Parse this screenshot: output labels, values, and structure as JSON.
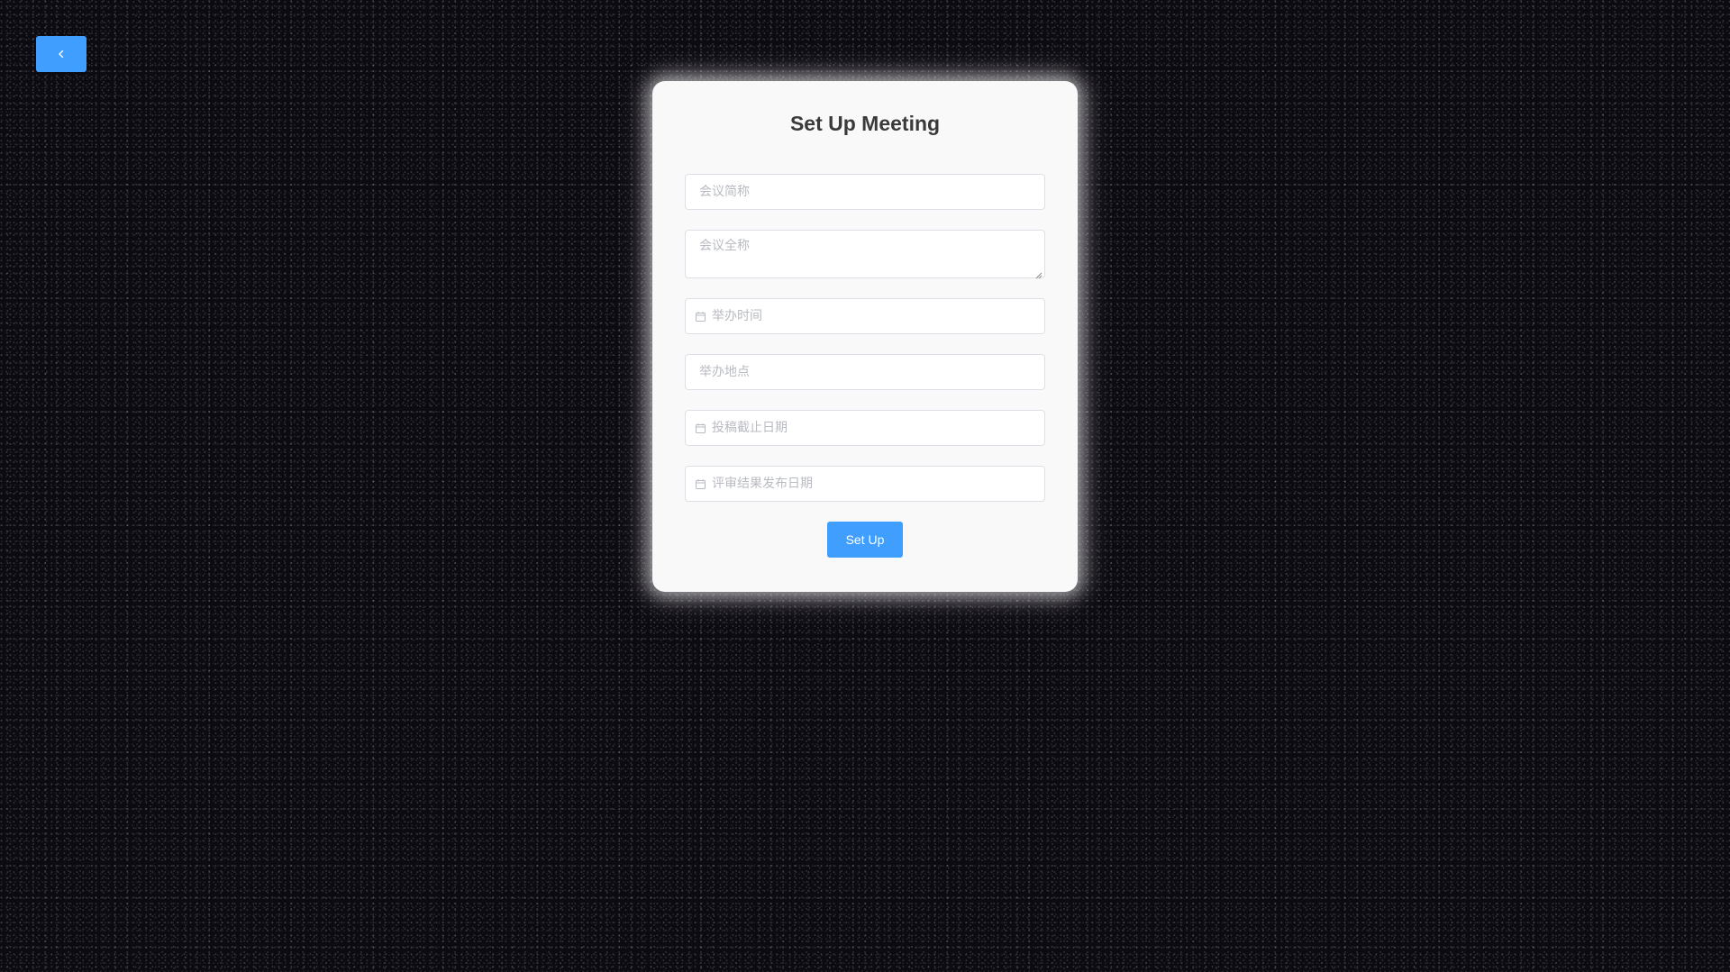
{
  "page": {
    "title": "Set Up Meeting"
  },
  "nav": {
    "back_icon": "chevron-left-icon",
    "accent_color": "#409eff"
  },
  "form": {
    "short_name": {
      "value": "",
      "placeholder": "会议简称"
    },
    "full_name": {
      "value": "",
      "placeholder": "会议全称"
    },
    "held_time": {
      "value": "",
      "placeholder": "举办时间",
      "icon": "calendar-icon"
    },
    "location": {
      "value": "",
      "placeholder": "举办地点"
    },
    "submission_deadline": {
      "value": "",
      "placeholder": "投稿截止日期",
      "icon": "calendar-icon"
    },
    "review_result_date": {
      "value": "",
      "placeholder": "评审结果发布日期",
      "icon": "calendar-icon"
    },
    "submit_label": "Set Up"
  }
}
